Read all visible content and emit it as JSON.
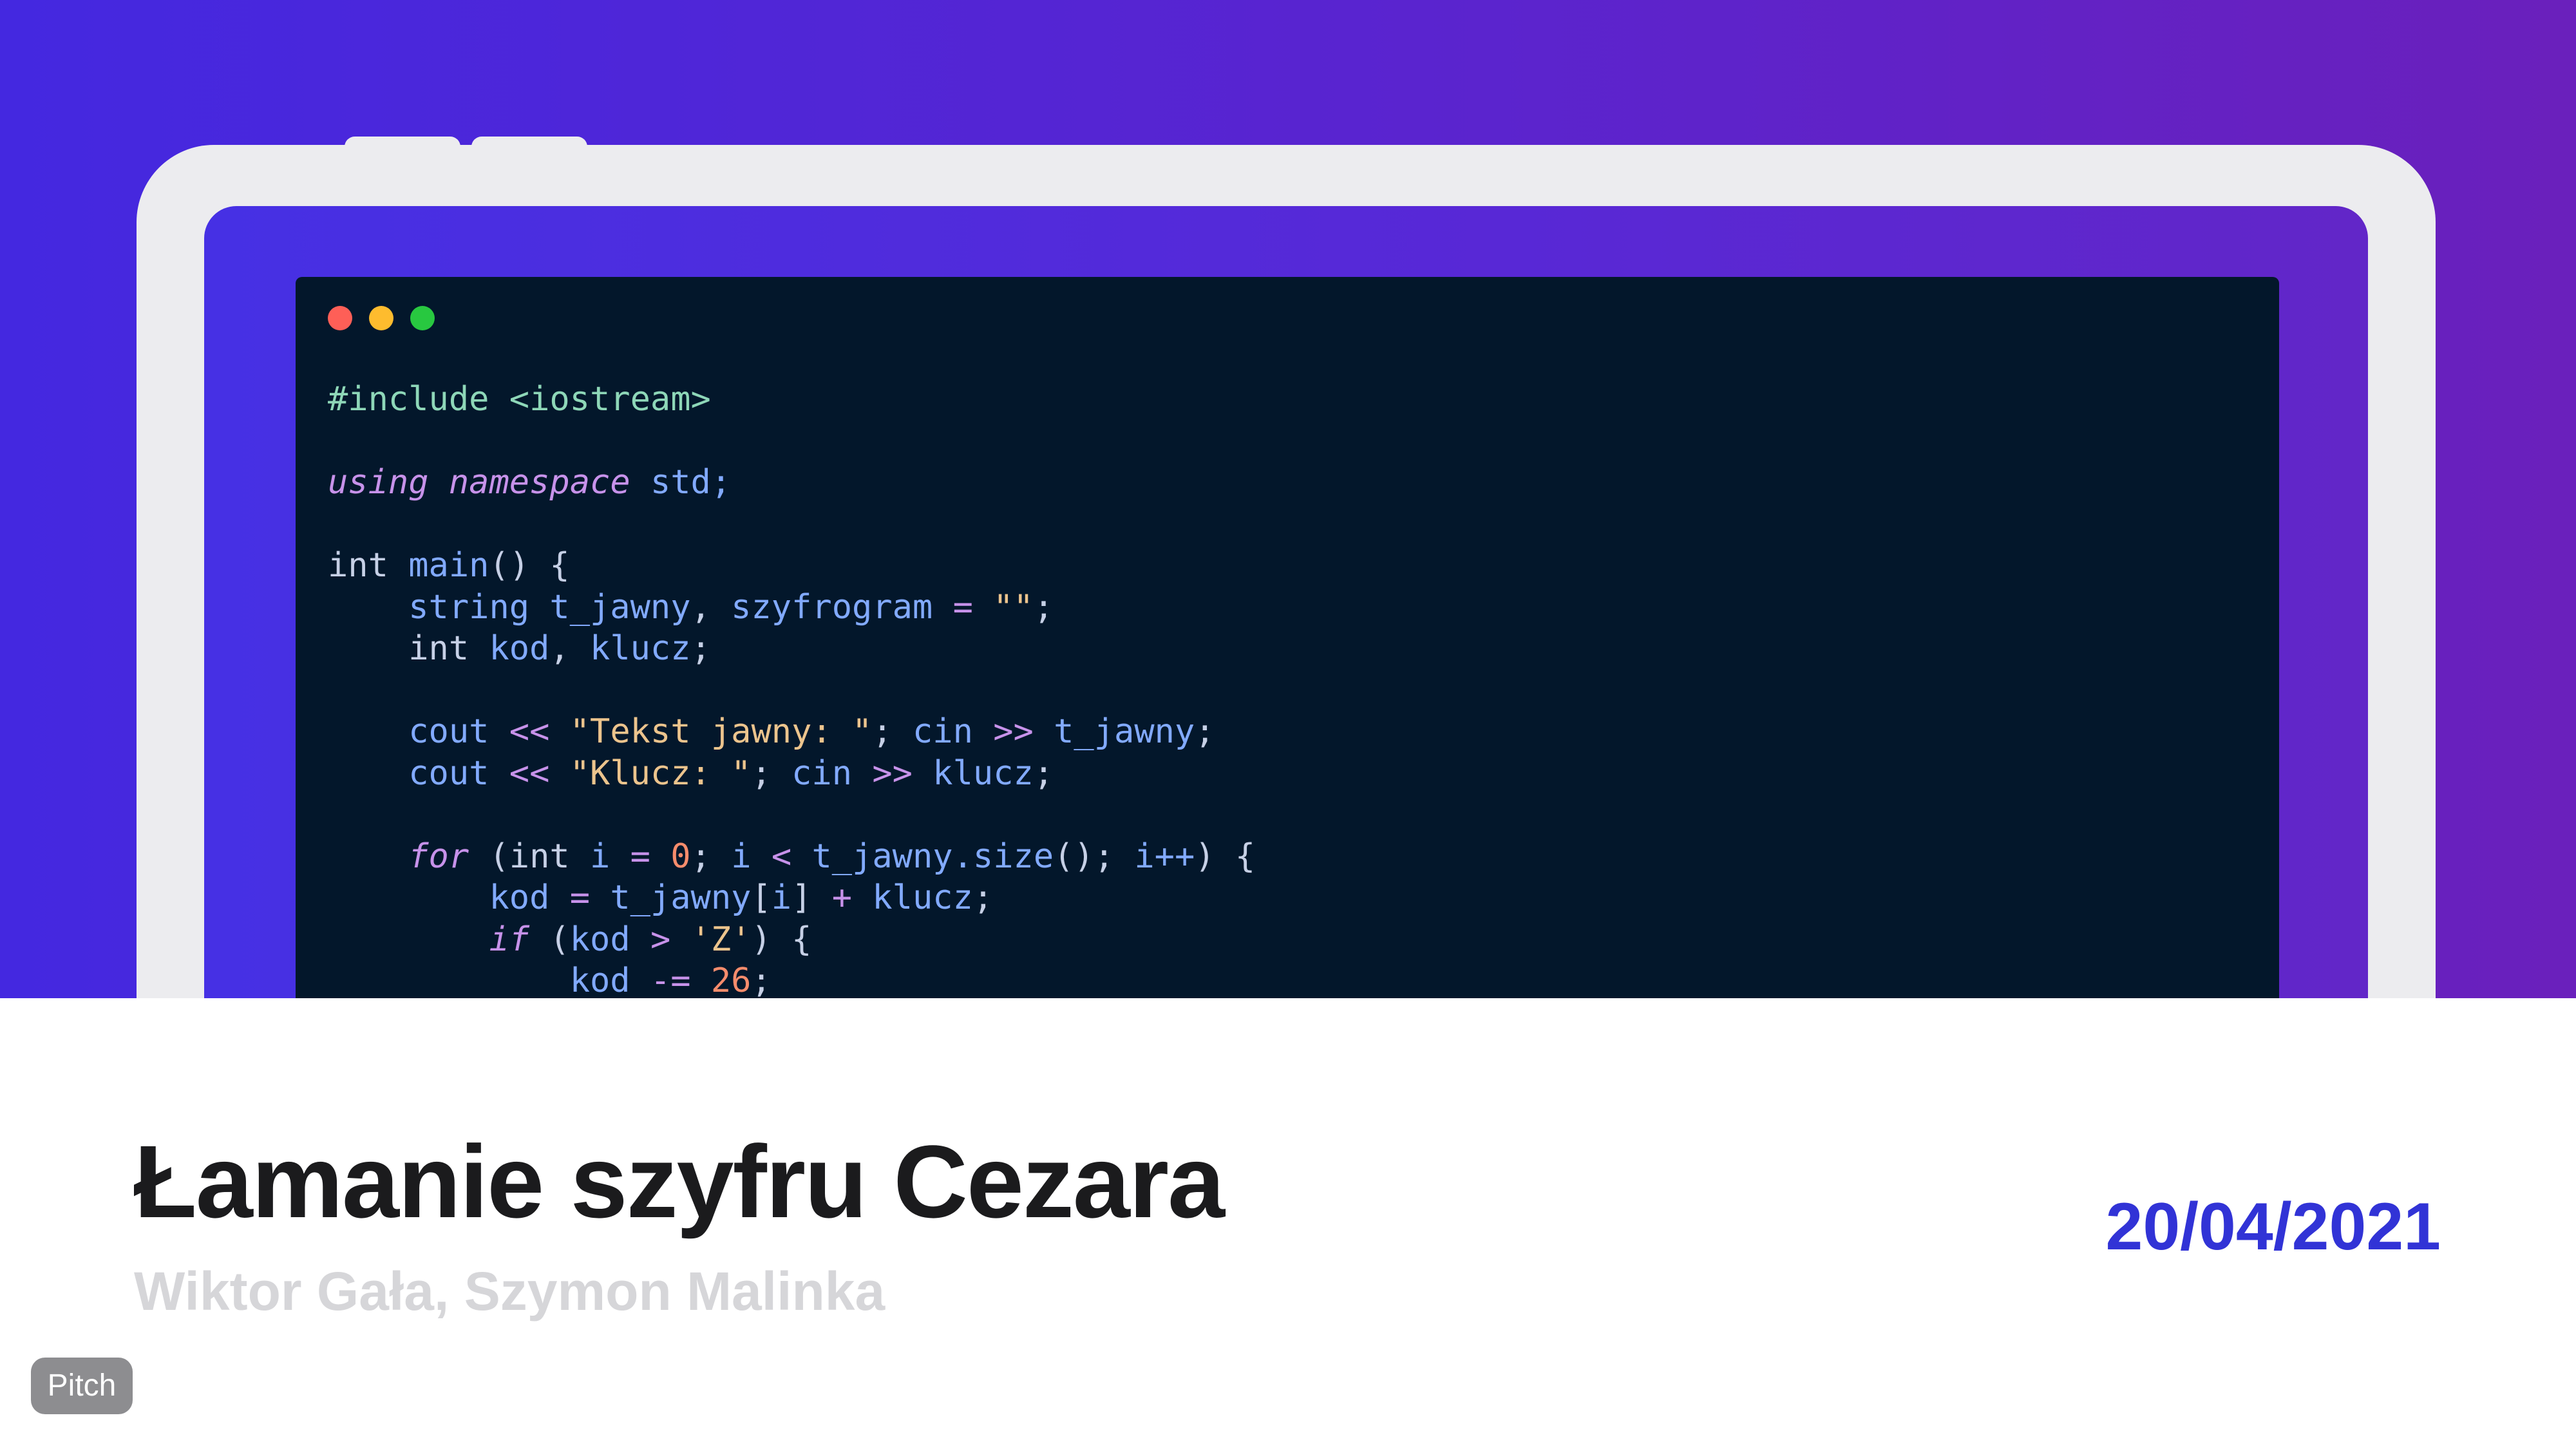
{
  "slide": {
    "title": "Łamanie szyfru Cezara",
    "subtitle": "Wiktor Gała, Szymon Malinka",
    "date": "20/04/2021",
    "badge_label": "Pitch"
  },
  "colors": {
    "gradient_start": "#4428e0",
    "gradient_end": "#6a20bc",
    "code_background": "#03172b",
    "title": "#1b1b1d",
    "subtitle": "#d6d6d9",
    "date": "#3133d6",
    "badge": "#8d8d90"
  },
  "window_controls": [
    "close-dot",
    "minimize-dot",
    "maximize-dot"
  ],
  "code": {
    "line1": "#include <iostream>",
    "line3_kw1": "using",
    "line3_kw2": "namespace",
    "line3_rest": "std;",
    "line5_type": "int",
    "line5_fn": "main",
    "line5_rest": "() {",
    "line6_type": "string",
    "line6_a": "t_jawny",
    "line6_b": "szyfrogram",
    "line6_str": "\"\"",
    "line7_type": "int",
    "line7_a": "kod",
    "line7_b": "klucz",
    "line9_cout": "cout",
    "line9_op1": "<<",
    "line9_str": "\"Tekst jawny: \"",
    "line9_cin": "cin",
    "line9_op2": ">>",
    "line9_var": "t_jawny",
    "line10_cout": "cout",
    "line10_op1": "<<",
    "line10_str": "\"Klucz: \"",
    "line10_cin": "cin",
    "line10_op2": ">>",
    "line10_var": "klucz",
    "line12_for": "for",
    "line12_type": "int",
    "line12_i1": "i",
    "line12_num": "0",
    "line12_i2": "i",
    "line12_op": "<",
    "line12_call": "t_jawny.size",
    "line12_inc": "i++",
    "line13_kod": "kod",
    "line13_arr": "t_jawny",
    "line13_idx": "i",
    "line13_klucz": "klucz",
    "line14_if": "if",
    "line14_kod": "kod",
    "line14_op": ">",
    "line14_str": "'Z'",
    "line15_kod": "kod",
    "line15_op": "-=",
    "line15_num": "26"
  }
}
